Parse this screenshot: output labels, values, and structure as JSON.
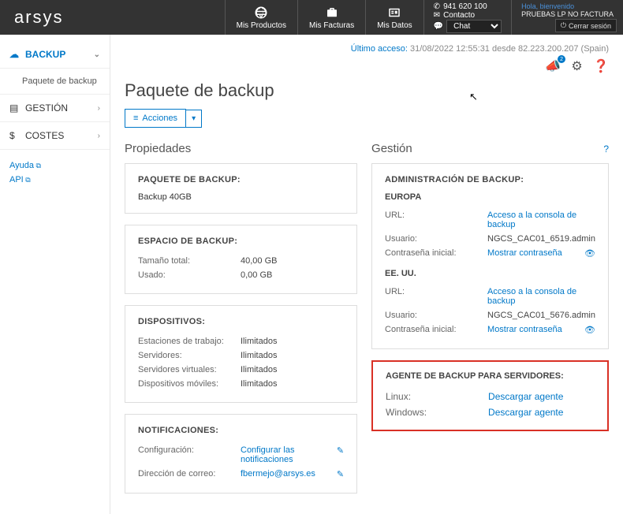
{
  "topbar": {
    "logo": "arsys",
    "products": "Mis Productos",
    "invoices": "Mis Facturas",
    "data": "Mis Datos",
    "phone": "941 620 100",
    "contact": "Contacto",
    "chat": "Chat",
    "greeting": "Hola, bienvenido",
    "username": "PRUEBAS LP NO FACTURA",
    "logout": "Cerrar sesión"
  },
  "sidebar": {
    "backup": "BACKUP",
    "backup_sub": "Paquete de backup",
    "gestion": "GESTIÓN",
    "costes": "COSTES",
    "ayuda": "Ayuda",
    "api": "API"
  },
  "lastaccess": {
    "label": "Último acceso:",
    "value": "31/08/2022 12:55:31 desde 82.223.200.207 (Spain)"
  },
  "page": {
    "title": "Paquete de backup",
    "actions": "Acciones"
  },
  "props": {
    "title": "Propiedades",
    "pkg_h": "PAQUETE DE BACKUP:",
    "pkg_v": "Backup 40GB",
    "space_h": "ESPACIO DE BACKUP:",
    "total_k": "Tamaño total:",
    "total_v": "40,00 GB",
    "used_k": "Usado:",
    "used_v": "0,00 GB",
    "dev_h": "DISPOSITIVOS:",
    "ws_k": "Estaciones de trabajo:",
    "ws_v": "Ilimitados",
    "srv_k": "Servidores:",
    "srv_v": "Ilimitados",
    "vsrv_k": "Servidores virtuales:",
    "vsrv_v": "Ilimitados",
    "mob_k": "Dispositivos móviles:",
    "mob_v": "Ilimitados",
    "notif_h": "NOTIFICACIONES:",
    "conf_k": "Configuración:",
    "conf_v": "Configurar las notificaciones",
    "mail_k": "Dirección de correo:",
    "mail_v": "fbermejo@arsys.es"
  },
  "mgmt": {
    "title": "Gestión",
    "admin_h": "ADMINISTRACIÓN DE BACKUP:",
    "eu_h": "EUROPA",
    "url_k": "URL:",
    "url_v": "Acceso a la consola de backup",
    "user_k": "Usuario:",
    "eu_user_v": "NGCS_CAC01_6519.admin",
    "pwd_k": "Contraseña inicial:",
    "pwd_v": "Mostrar contraseña",
    "us_h": "EE. UU.",
    "us_user_v": "NGCS_CAC01_5676.admin",
    "agent_h": "AGENTE DE BACKUP PARA SERVIDORES:",
    "linux_k": "Linux:",
    "linux_v": "Descargar agente",
    "win_k": "Windows:",
    "win_v": "Descargar agente"
  }
}
